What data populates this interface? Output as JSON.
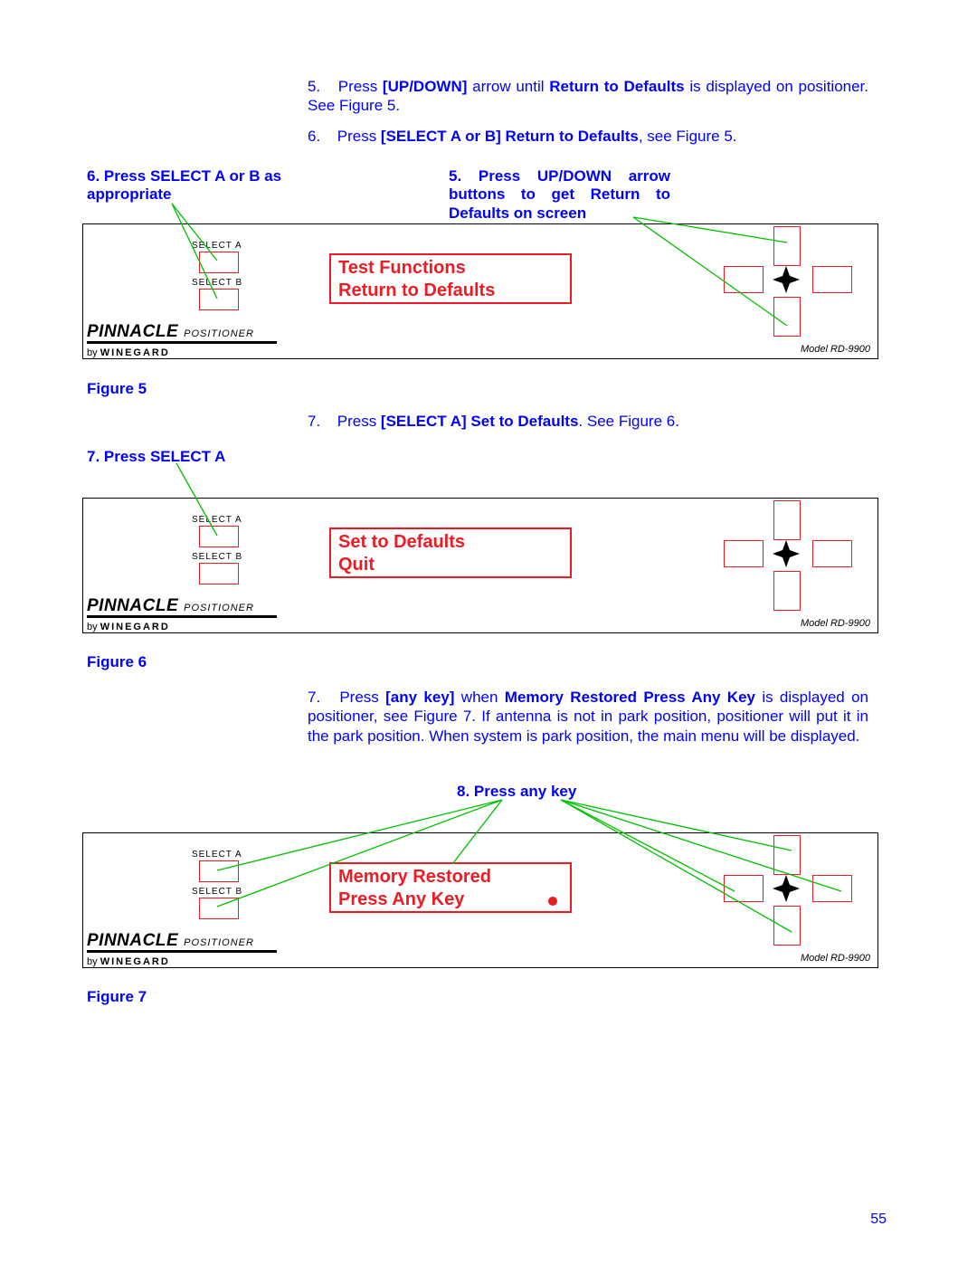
{
  "instructions": {
    "i5_prefix": "5.",
    "i5_a": "Press ",
    "i5_b": "[UP/DOWN]",
    "i5_c": " arrow until ",
    "i5_d": "Return to Defaults",
    "i5_e": " is displayed on positioner.  See Figure 5.",
    "i6_prefix": "6.",
    "i6_a": "Press ",
    "i6_b": "[SELECT A or B] Return to Defaults",
    "i6_c": ", see Figure 5.",
    "i7a_prefix": "7.",
    "i7a_a": "Press ",
    "i7a_b": "[SELECT A] Set to Defaults",
    "i7a_c": ".  See Figure 6.",
    "i7b_prefix": "7.",
    "i7b_a": "Press ",
    "i7b_b": "[any key]",
    "i7b_c": " when ",
    "i7b_d": "Memory Restored Press Any Key",
    "i7b_e": " is displayed on positioner, see Figure 7.  If antenna is not in park position, positioner will put it in the park position.  When system is park position, the main menu will be displayed."
  },
  "callouts": {
    "c6": "6. Press SELECT A or B as appropriate",
    "c5": "5. Press UP/DOWN arrow buttons to get Return to Defaults on screen",
    "c7a": "7. Press SELECT A",
    "c8": "8. Press any key"
  },
  "captions": {
    "f5": "Figure 5",
    "f6": "Figure 6",
    "f7": "Figure 7"
  },
  "panel": {
    "select_a": "SELECT A",
    "select_b": "SELECT B",
    "pinnacle": "PINNACLE",
    "positioner": "POSITIONER",
    "by": "by",
    "winegard": "WINEGARD",
    "model": "Model RD-9900",
    "lcd1_line1": "Test Functions",
    "lcd1_line2": "Return to Defaults",
    "lcd2_line1": "Set to Defaults",
    "lcd2_line2": "Quit",
    "lcd3_line1": "Memory Restored",
    "lcd3_line2": "Press Any Key"
  },
  "page_number": "55"
}
